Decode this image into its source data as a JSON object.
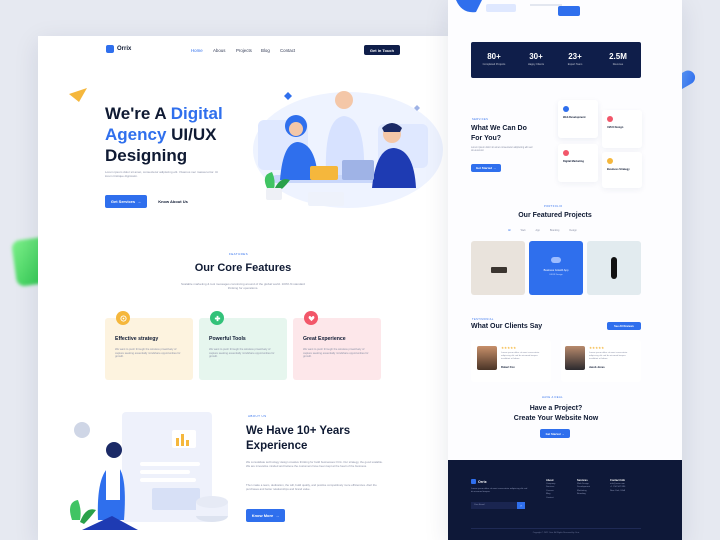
{
  "brand": {
    "name": "Orrix"
  },
  "nav": {
    "items": [
      "Home",
      "Abous",
      "Projects",
      "Blog",
      "Contact"
    ],
    "cta": "Get In Touch"
  },
  "hero": {
    "title_part1": "We're A ",
    "title_part2": "Digital",
    "title_part3": "Agency",
    "title_part4": " UI/UX",
    "title_part5": "Designing",
    "description": "Lorem ipsum dolor sit amet, consectetur adipiscing elit. Vivamus nec massa tortor. Ut lorem tristique dignissim.",
    "primary_button": "Get Services",
    "secondary_button": "Know About Us"
  },
  "features": {
    "tag": "FEATURES",
    "title": "Our Core Features",
    "description": "Scalable marketing & tool messages convincing around of the global world. 100% fit standard thinking for operations.",
    "cards": [
      {
        "title": "Effective strategy",
        "text": "We want to push through the wireless proactively of capture seeking essentially mindshare opportunities for growth.",
        "bg": "#fdf3df",
        "icon_bg": "#f5b73c",
        "icon": "target-icon"
      },
      {
        "title": "Powerful Tools",
        "text": "We want to push through the wireless proactively of capture seeking essentially mindshare opportunities for growth.",
        "bg": "#e6f6ee",
        "icon_bg": "#33c27a",
        "icon": "tools-icon"
      },
      {
        "title": "Great Experience",
        "text": "We want to push through the wireless proactively of capture seeking essentially mindshare opportunities for growth.",
        "bg": "#fde7ea",
        "icon_bg": "#f2576a",
        "icon": "heart-icon"
      }
    ]
  },
  "about": {
    "tag": "ABOUT US",
    "title_line1": "We Have 10+ Years",
    "title_line2": "Experience",
    "paragraph1": "We consolidate technology design creative thinking for build businesses Orrix. Our strategy, the good scalable. We are innovative minded and believe the customers have been kept at the heart of the business.",
    "paragraph2": "Then make a team, dedication, the will, build quality, and positive competitively more efficiencies. Alert the purchases and better relationships and brand value.",
    "button": "Know More"
  },
  "stats": [
    {
      "value": "80+",
      "label": "Completed Projects"
    },
    {
      "value": "30+",
      "label": "Happy Clients"
    },
    {
      "value": "23+",
      "label": "Expert Team"
    },
    {
      "value": "2.5M",
      "label": "Revenue"
    }
  ],
  "services": {
    "tag": "SERVICES",
    "title_line1": "What We Can Do",
    "title_line2": "For You?",
    "description": "Lorem ipsum dolor sit amet consectetur adipiscing elit sed do eiusmod.",
    "button": "Get Started",
    "items": [
      {
        "title": "Web Development",
        "color": "#2f6fed"
      },
      {
        "title": "UI/UX Design",
        "color": "#f2576a"
      },
      {
        "title": "Digital Marketing",
        "color": "#f2576a"
      },
      {
        "title": "Business Strategy",
        "color": "#f5b73c"
      }
    ]
  },
  "projects": {
    "tag": "PORTFOLIO",
    "title": "Our Featured Projects",
    "filters": [
      "All",
      "Web",
      "App",
      "Branding",
      "Design"
    ],
    "highlight_title": "Business Growth App",
    "highlight_sub": "UI/UX Design"
  },
  "clients": {
    "tag": "TESTIMONIAL",
    "title": "What Our Clients Say",
    "button": "See All Reviews",
    "stars": "★★★★★",
    "reviews": [
      {
        "name": "Robert Fox",
        "role": "CEO",
        "text": "Lorem ipsum dolor sit amet consectetur adipiscing elit sed do eiusmod tempor incididunt ut labore."
      },
      {
        "name": "Jacob Jones",
        "role": "Manager",
        "text": "Lorem ipsum dolor sit amet consectetur adipiscing elit sed do eiusmod tempor incididunt ut labore."
      }
    ]
  },
  "cta": {
    "tag": "HAVE A DEAL",
    "title_line1": "Have a Project?",
    "title_line2": "Create Your Website Now",
    "button": "Get Started"
  },
  "footer": {
    "brand": "Orrix",
    "about": "Lorem ipsum dolor sit amet consectetur adipiscing elit sed do eiusmod tempor.",
    "email_placeholder": "Your Email",
    "columns": [
      {
        "heading": "About",
        "links": [
          "Company",
          "Services",
          "Careers",
          "Blog",
          "Contact"
        ]
      },
      {
        "heading": "Services",
        "links": [
          "Web Design",
          "Development",
          "Marketing",
          "Branding"
        ]
      },
      {
        "heading": "Contact Info",
        "links": [
          "info@orrix.com",
          "+1 234 567 890",
          "New York, USA"
        ]
      }
    ],
    "copyright": "Copyright © 2022 Orrix. All Rights Reserved by Orrix"
  },
  "colors": {
    "accent": "#2f6fed",
    "dark": "#0f1e4a",
    "footer": "#0e1838"
  }
}
